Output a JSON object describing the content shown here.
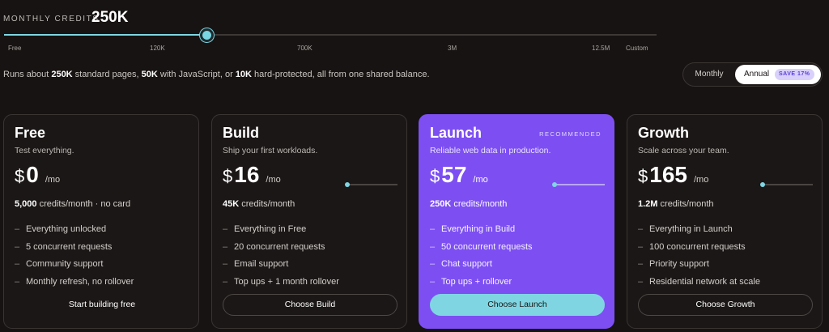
{
  "credits": {
    "label": "MONTHLY CREDITS",
    "value": "250K",
    "slider_value_fraction": 0.31,
    "ticks": [
      "Free",
      "120K",
      "700K",
      "3M",
      "12.5M",
      "Custom"
    ]
  },
  "description": {
    "prefix": "Runs about ",
    "v1": "250K",
    "mid1": " standard pages, ",
    "v2": "50K",
    "mid2": " with JavaScript, or ",
    "v3": "10K",
    "suffix": " hard-protected, all from one shared balance."
  },
  "billing": {
    "monthly": "Monthly",
    "annual": "Annual",
    "save_badge": "SAVE 17%",
    "selected": "Annual"
  },
  "colors": {
    "accent_cyan": "#7fd6e2",
    "featured_purple": "#7d4ff2",
    "background": "#171312"
  },
  "plans": [
    {
      "name": "Free",
      "tagline": "Test everything.",
      "currency": "$",
      "price": "0",
      "period": "/mo",
      "credits_bold": "5,000",
      "credits_rest": " credits/month · no card",
      "features": [
        "Everything unlocked",
        "5 concurrent requests",
        "Community support",
        "Monthly refresh, no rollover"
      ],
      "cta": "Start building free"
    },
    {
      "name": "Build",
      "tagline": "Ship your first workloads.",
      "currency": "$",
      "price": "16",
      "period": "/mo",
      "credits_bold": "45K",
      "credits_rest": " credits/month",
      "features": [
        "Everything in Free",
        "20 concurrent requests",
        "Email support",
        "Top ups + 1 month rollover"
      ],
      "cta": "Choose Build"
    },
    {
      "name": "Launch",
      "badge": "RECOMMENDED",
      "tagline": "Reliable web data in production.",
      "currency": "$",
      "price": "57",
      "period": "/mo",
      "credits_bold": "250K",
      "credits_rest": " credits/month",
      "features": [
        "Everything in Build",
        "50 concurrent requests",
        "Chat support",
        "Top ups + rollover"
      ],
      "cta": "Choose Launch"
    },
    {
      "name": "Growth",
      "tagline": "Scale across your team.",
      "currency": "$",
      "price": "165",
      "period": "/mo",
      "credits_bold": "1.2M",
      "credits_rest": " credits/month",
      "features": [
        "Everything in Launch",
        "100 concurrent requests",
        "Priority support",
        "Residential network at scale"
      ],
      "cta": "Choose Growth"
    }
  ]
}
